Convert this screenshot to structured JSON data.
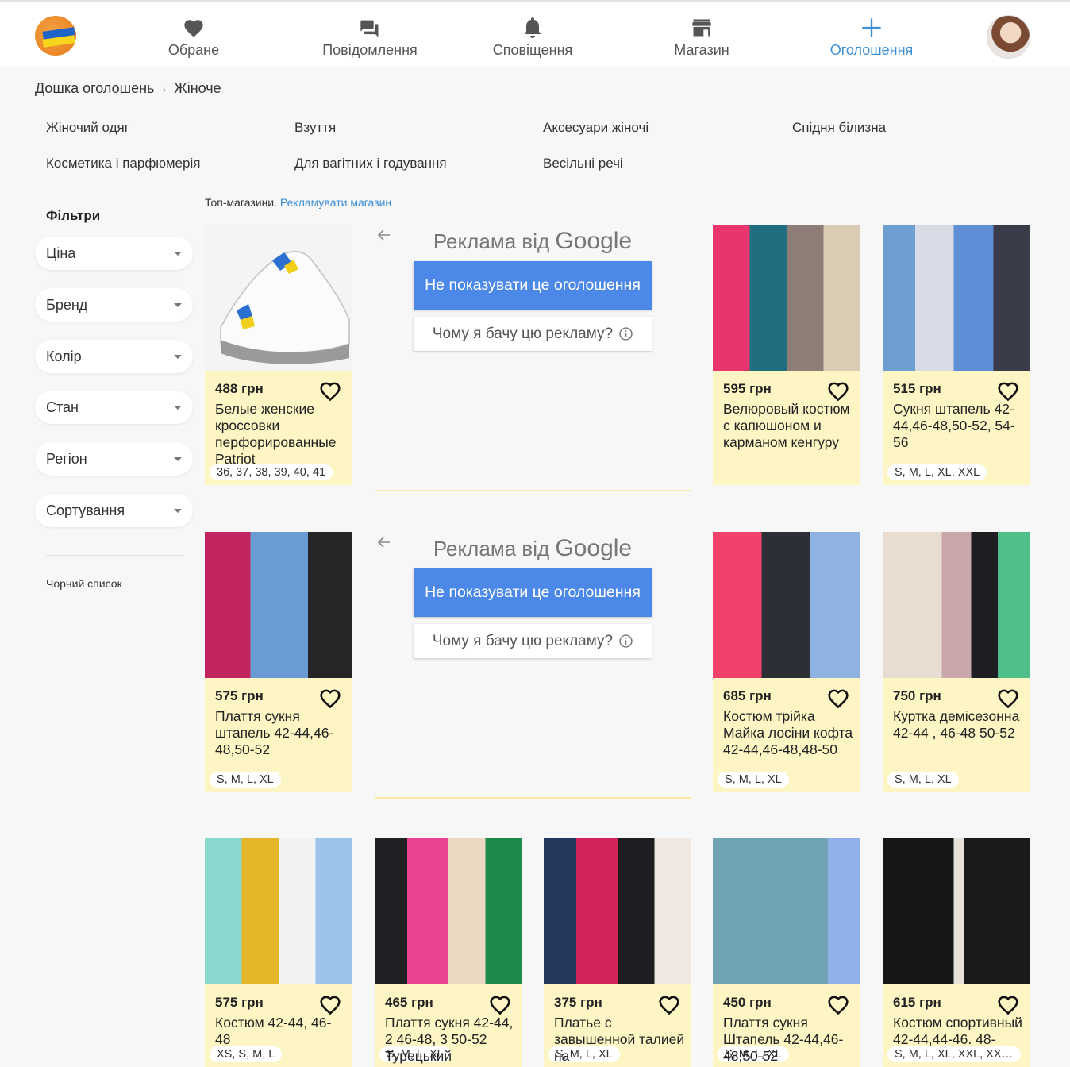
{
  "nav": {
    "favorites": "Обране",
    "messages": "Повідомлення",
    "notifications": "Сповіщення",
    "shop": "Магазин",
    "new_ad": "Оголошення"
  },
  "breadcrumb": {
    "root": "Дошка оголошень",
    "current": "Жіноче"
  },
  "categories": [
    "Жіночий одяг",
    "Взуття",
    "Аксесуари жіночі",
    "Спідня білизна",
    "Косметика і парфюмерія",
    "Для вагітних і годування",
    "Весільні речі"
  ],
  "filters": {
    "title": "Фільтри",
    "items": [
      "Ціна",
      "Бренд",
      "Колір",
      "Стан",
      "Регіон",
      "Сортування"
    ],
    "blacklist": "Чорний список"
  },
  "top_shops": {
    "label": "Топ-магазини.",
    "link": "Рекламувати магазин"
  },
  "ads": {
    "title_prefix": "Реклама від",
    "title_brand": "Google",
    "hide_button": "Не показувати це оголошення",
    "why_button": "Чому я бачу цю рекламу?"
  },
  "listings": [
    {
      "price": "488 грн",
      "title": "Белые женские кроссовки перфорированные Patriot",
      "sizes": "36, 37, 38, 39, 40, 41"
    },
    {
      "price": "595 грн",
      "title": "Велюровый костюм с капюшоном и карманом кенгуру",
      "sizes": ""
    },
    {
      "price": "515 грн",
      "title": "Сукня штапель 42-44,46-48,50-52, 54-56",
      "sizes": "S, M, L, XL, XXL"
    },
    {
      "price": "575 грн",
      "title": "Плаття сукня штапель 42-44,46-48,50-52",
      "sizes": "S, M, L, XL"
    },
    {
      "price": "685 грн",
      "title": "Костюм трійка Майка лосіни кофта 42-44,46-48,48-50",
      "sizes": "S, M, L, XL"
    },
    {
      "price": "750 грн",
      "title": "Куртка демісезонна 42-44 , 46-48 50-52",
      "sizes": "S, M, L, XL"
    },
    {
      "price": "575 грн",
      "title": "Костюм 42-44, 46-48",
      "sizes": "XS, S, M, L"
    },
    {
      "price": "465 грн",
      "title": "Плаття сукня 42-44, 2 46-48, 3 50-52 Турецький",
      "sizes": "S, M, L, XL"
    },
    {
      "price": "375 грн",
      "title": "Платье с завышенной талией на",
      "sizes": "S, M, L, XL"
    },
    {
      "price": "450 грн",
      "title": "Плаття сукня Штапель 42-44,46-48,50-52",
      "sizes": "S, M, L, XL"
    },
    {
      "price": "615 грн",
      "title": "Костюм спортивный 42-44,44-46. 48-",
      "sizes": "S, M, L, XL, XXL, XXXL"
    }
  ],
  "colors": {
    "accent": "#3b8fd6",
    "card_bg": "#fdf5c3",
    "ad_blue": "#4c88e8"
  }
}
